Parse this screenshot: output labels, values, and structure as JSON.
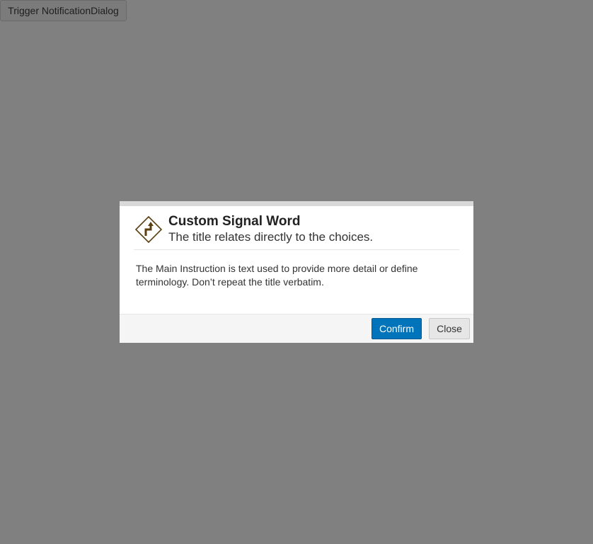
{
  "trigger": {
    "label": "Trigger NotificationDialog"
  },
  "dialog": {
    "icon": "sharp-turn-road-sign-icon",
    "title": "Custom Signal Word",
    "subtitle": "The title relates directly to the choices.",
    "body": "The Main Instruction is text used to provide more detail or define terminology. Don’t repeat the title verbatim.",
    "buttons": {
      "confirm": "Confirm",
      "close": "Close"
    }
  },
  "colors": {
    "backdrop": "#808080",
    "confirm_button": "#0074bb",
    "icon_brown": "#5b3f12"
  }
}
